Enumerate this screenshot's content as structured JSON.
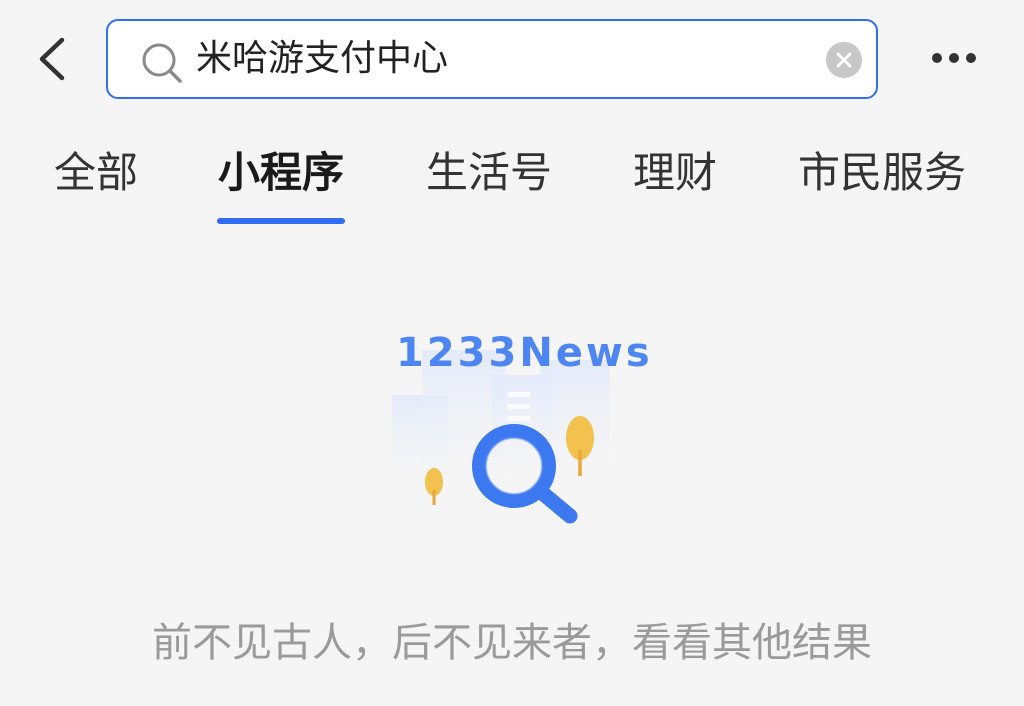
{
  "header": {
    "search_query": "米哈游支付中心",
    "back_icon": "chevron-left-icon",
    "search_icon": "search-icon",
    "clear_icon": "clear-icon",
    "more_icon": "more-horizontal-icon"
  },
  "tabs": [
    {
      "label": "全部",
      "active": false
    },
    {
      "label": "小程序",
      "active": true
    },
    {
      "label": "生活号",
      "active": false
    },
    {
      "label": "理财",
      "active": false
    },
    {
      "label": "市民服务",
      "active": false
    }
  ],
  "empty_state": {
    "illustration_icon": "magnifier-icon",
    "watermark": "1233News",
    "message": "前不见古人，后不见来者，看看其他结果"
  },
  "colors": {
    "accent": "#2f6df2",
    "background": "#f5f5f5",
    "muted_text": "#9a9a9a",
    "tree": "#f2c14e"
  }
}
